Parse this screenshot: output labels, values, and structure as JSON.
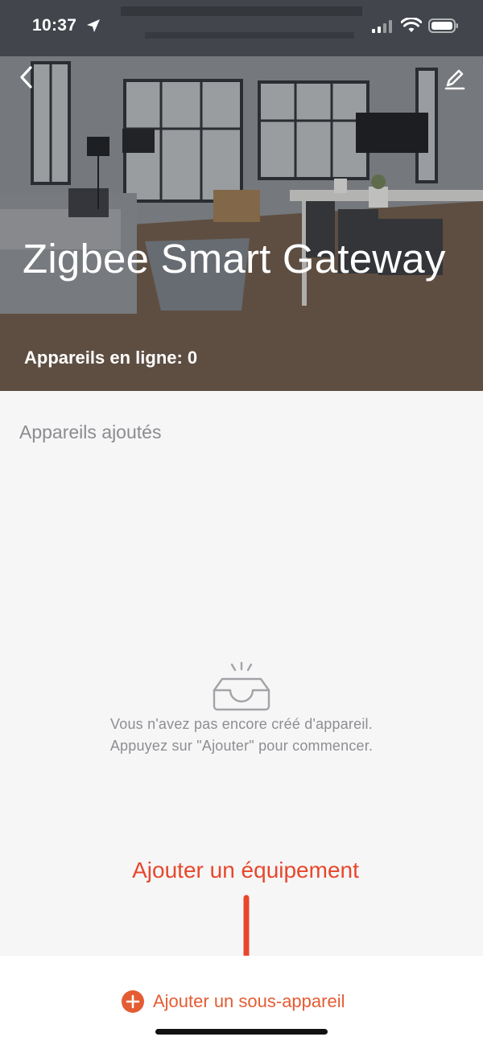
{
  "status_bar": {
    "time": "10:37"
  },
  "header": {
    "title": "Zigbee Smart Gateway",
    "online_devices": "Appareils en ligne: 0"
  },
  "content": {
    "section_label": "Appareils ajoutés",
    "empty_line1": "Vous n'avez pas encore créé d'appareil.",
    "empty_line2": "Appuyez sur \"Ajouter\" pour commencer."
  },
  "annotation": {
    "text": "Ajouter un équipement"
  },
  "bottom": {
    "add_subdevice_label": "Ajouter un sous-appareil"
  },
  "colors": {
    "accent": "#e45c33",
    "annotation": "#e8472c",
    "muted_text": "#8e8e93"
  }
}
